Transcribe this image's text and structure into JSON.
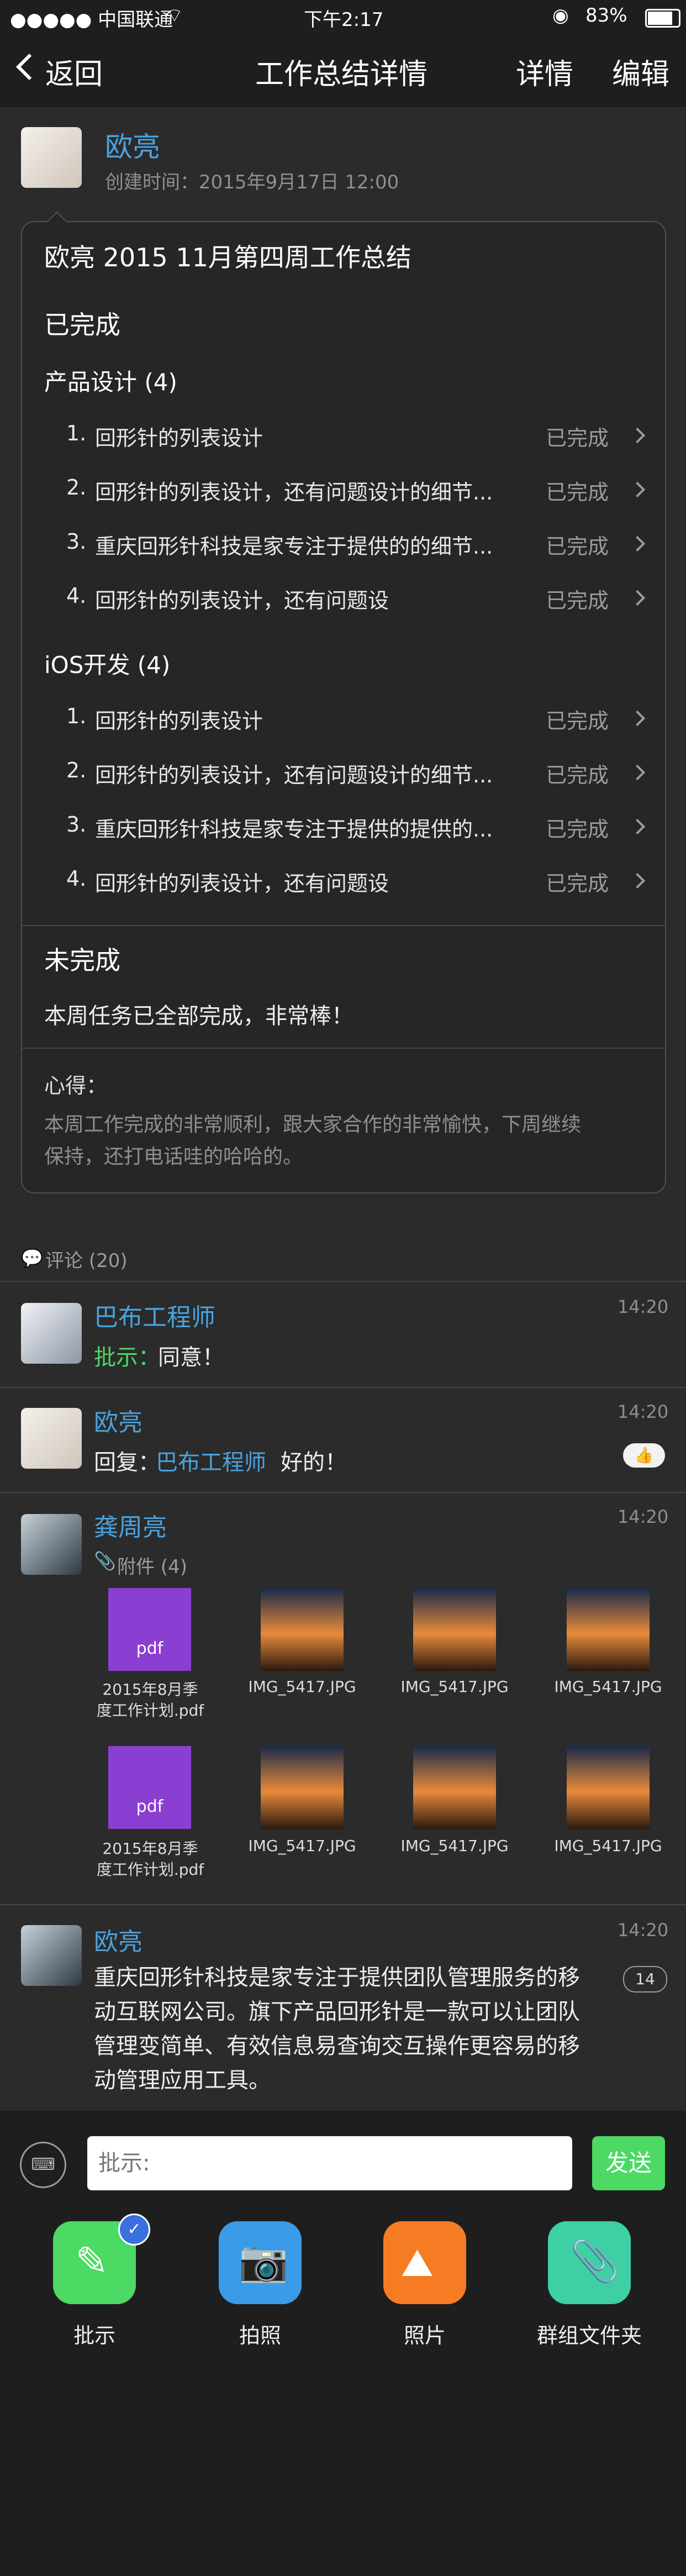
{
  "status_bar": {
    "carrier": "●●●●● 中国联通",
    "time": "下午2:17",
    "battery": "83%"
  },
  "nav": {
    "back_label": "返回",
    "title": "工作总结详情",
    "detail_label": "详情",
    "edit_label": "编辑"
  },
  "author": {
    "name": "欧亮",
    "created": "创建时间：2015年9月17日  12:00"
  },
  "summary": {
    "title": "欧亮 2015 11月第四周工作总结",
    "completed_heading": "已完成",
    "groups": [
      {
        "name": "产品设计 (4)",
        "items": [
          {
            "num": "1.",
            "text": "回形针的列表设计",
            "status": "已完成"
          },
          {
            "num": "2.",
            "text": "回形针的列表设计，还有问题设计的细节...",
            "status": "已完成"
          },
          {
            "num": "3.",
            "text": "重庆回形针科技是家专注于提供的的细节...",
            "status": "已完成"
          },
          {
            "num": "4.",
            "text": "回形针的列表设计，还有问题设",
            "status": "已完成"
          }
        ]
      },
      {
        "name": "iOS开发 (4)",
        "items": [
          {
            "num": "1.",
            "text": "回形针的列表设计",
            "status": "已完成"
          },
          {
            "num": "2.",
            "text": "回形针的列表设计，还有问题设计的细节...",
            "status": "已完成"
          },
          {
            "num": "3.",
            "text": "重庆回形针科技是家专注于提供的提供的...",
            "status": "已完成"
          },
          {
            "num": "4.",
            "text": "回形针的列表设计，还有问题设",
            "status": "已完成"
          }
        ]
      }
    ],
    "incomplete_heading": "未完成",
    "incomplete_text": "本周任务已全部完成，非常棒！",
    "insight_label": "心得：",
    "insight_line1": "本周工作完成的非常顺利，跟大家合作的非常愉快，下周继续",
    "insight_line2": "保持，还打电话哇的哈哈的。"
  },
  "comments": {
    "header": "评论 (20)",
    "list": [
      {
        "name": "巴布工程师",
        "time": "14:20",
        "prefix": "批示：",
        "text": "同意！"
      },
      {
        "name": "欧亮",
        "time": "14:20",
        "prefix": "回复：",
        "mention": "巴布工程师",
        "text": "好的！"
      },
      {
        "name": "龚周亮",
        "time": "14:20",
        "attach_label": "附件 (4)"
      },
      {
        "name": "欧亮",
        "time": "14:20",
        "badge": "14",
        "line1": "重庆回形针科技是家专注于提供团队管理服务的移",
        "line2": "动互联网公司。旗下产品回形针是一款可以让团队",
        "line3": "管理变简单、有效信息易查询交互操作更容易的移",
        "line4": "动管理应用工具。"
      }
    ],
    "files": [
      {
        "type": "pdf",
        "label": "pdf",
        "cap1": "2015年8月季",
        "cap2": "度工作计划.pdf"
      },
      {
        "type": "img",
        "cap1": "IMG_5417.JPG"
      },
      {
        "type": "img",
        "cap1": "IMG_5417.JPG"
      },
      {
        "type": "img",
        "cap1": "IMG_5417.JPG"
      },
      {
        "type": "pdf",
        "label": "pdf",
        "cap1": "2015年8月季",
        "cap2": "度工作计划.pdf"
      },
      {
        "type": "img",
        "cap1": "IMG_5417.JPG"
      },
      {
        "type": "img",
        "cap1": "IMG_5417.JPG"
      },
      {
        "type": "img",
        "cap1": "IMG_5417.JPG"
      }
    ]
  },
  "input": {
    "placeholder": "批示:",
    "send_label": "发送"
  },
  "actions": [
    {
      "label": "批示",
      "color": "#4cd964"
    },
    {
      "label": "拍照",
      "color": "#3a9be8"
    },
    {
      "label": "照片",
      "color": "#f57c23"
    },
    {
      "label": "群组文件夹",
      "color": "#3ecfa4"
    }
  ]
}
